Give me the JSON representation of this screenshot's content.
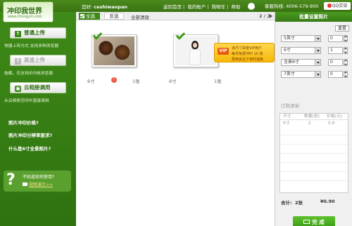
{
  "app": {
    "logo": "冲印我世界",
    "logo_sub": "www.chongyin.com"
  },
  "topbar": {
    "greeting_prefix": "您好:",
    "username": "ceshiwanpan",
    "nav": [
      "返回首页",
      "我的账户",
      "购物车",
      "帮助"
    ],
    "separator": "|",
    "phone": "客服热线: 4006-579-900",
    "qq_label": "QQ交谈"
  },
  "sidebar": {
    "upload_normal": "普通上传",
    "upload_normal_hint": "快捷上传方式 支持多种浏览器",
    "upload_fast": "高速上传",
    "upload_fast_hint": "拖载、仅支持IE内核浏览器",
    "cloud_album": "云相册调用",
    "cloud_album_hint": "从云相册空间中直接调用",
    "faq": [
      "照片冲印价格?",
      "照片冲印分辨率要求?",
      "什么是6寸全景照片?"
    ],
    "help_q": "?",
    "help_text": "不知道如何使用?",
    "help_video": "视频演示>>"
  },
  "toolbar": {
    "select_all": "全选",
    "invert": "反选",
    "clear_all": "全部清除",
    "page": "2 / 2"
  },
  "photos": [
    {
      "size": "6寸",
      "count": "1张",
      "delete": "!"
    },
    {
      "size": "6寸",
      "count": "1张"
    }
  ],
  "vip_tag": {
    "badge": "VIP",
    "line1": "该尺寸百度VIP用户",
    "line2": "每月免费冲印 10 张",
    "line3": "费用会在下单时减免"
  },
  "right_panel": {
    "header": "批量设置照片",
    "reset": "重置",
    "rows": [
      {
        "size": "5英寸",
        "qty": "0"
      },
      {
        "size": "6寸",
        "qty": "1"
      },
      {
        "size": "全景6寸",
        "qty": "0"
      },
      {
        "size": "7英寸",
        "qty": "0"
      }
    ],
    "order_title": "订购清单:",
    "table_headers": [
      "尺寸",
      "数量(张)",
      "价格(元)"
    ],
    "table_rows": [
      {
        "size": "6寸",
        "qty": "2",
        "price": "0.9"
      }
    ],
    "total_label": "合计:",
    "total_count": "2张",
    "total_amount": "¥0.90",
    "done": "完 成"
  }
}
